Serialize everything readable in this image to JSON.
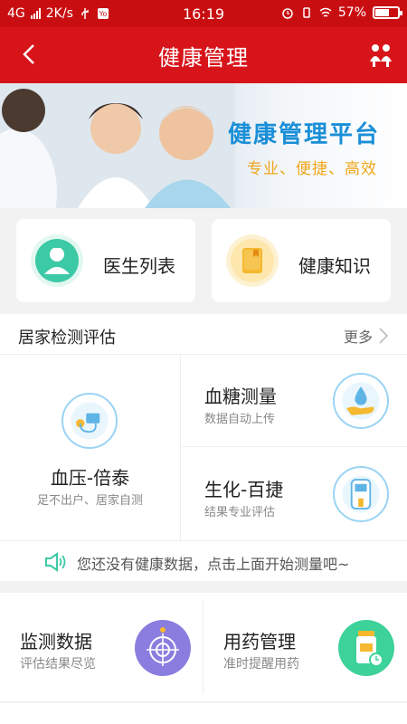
{
  "status": {
    "network": "4G",
    "speed": "2K/s",
    "time": "16:19",
    "battery": "57%"
  },
  "header": {
    "title": "健康管理",
    "back_icon": "back-arrow-icon",
    "right_icon": "family-icon"
  },
  "banner": {
    "title": "健康管理平台",
    "subtitle": "专业、便捷、高效"
  },
  "quick": [
    {
      "label": "医生列表",
      "icon": "doctor-icon",
      "color": "#3cc9a6"
    },
    {
      "label": "健康知识",
      "icon": "book-icon",
      "color": "#f5b82e"
    }
  ],
  "home_test": {
    "title": "居家检测评估",
    "more": "更多",
    "main": {
      "title": "血压-倍泰",
      "subtitle": "足不出户、居家自测",
      "icon": "blood-pressure-icon"
    },
    "items": [
      {
        "title": "血糖测量",
        "subtitle": "数据自动上传",
        "icon": "blood-sugar-icon"
      },
      {
        "title": "生化-百捷",
        "subtitle": "结果专业评估",
        "icon": "analyzer-icon"
      }
    ],
    "notice": "您还没有健康数据，点击上面开始测量吧~"
  },
  "bottom": [
    {
      "title": "监测数据",
      "subtitle": "评估结果尽览",
      "icon": "target-icon",
      "color": "#8a7de0"
    },
    {
      "title": "用药管理",
      "subtitle": "准时提醒用药",
      "icon": "medicine-icon",
      "color": "#3cd29a"
    }
  ],
  "colors": {
    "primary": "#d7141a",
    "accent_blue": "#1a8fd8",
    "accent_orange": "#f0a61b"
  }
}
